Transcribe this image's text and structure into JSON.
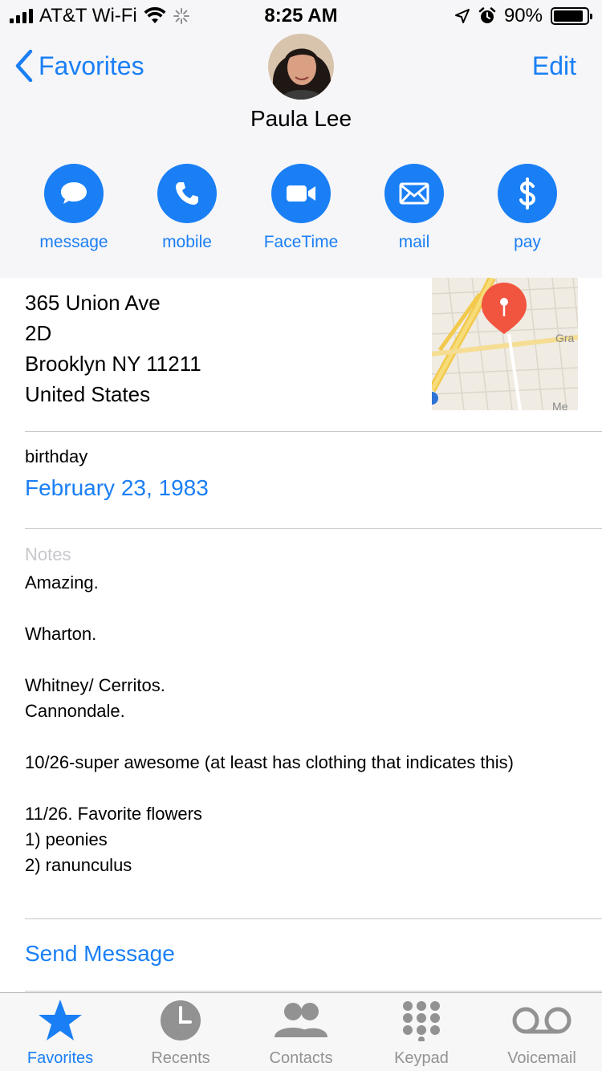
{
  "status_bar": {
    "carrier": "AT&T Wi-Fi",
    "time": "8:25 AM",
    "battery_percent": "90%",
    "battery_level": 0.9
  },
  "nav": {
    "back_label": "Favorites",
    "edit_label": "Edit"
  },
  "contact": {
    "name": "Paula Lee"
  },
  "actions": [
    {
      "label": "message",
      "icon": "message-bubble-icon"
    },
    {
      "label": "mobile",
      "icon": "phone-icon"
    },
    {
      "label": "FaceTime",
      "icon": "video-camera-icon"
    },
    {
      "label": "mail",
      "icon": "envelope-icon"
    },
    {
      "label": "pay",
      "icon": "dollar-icon"
    }
  ],
  "address": {
    "line1": "365 Union Ave",
    "line2": "2D",
    "line3": "Brooklyn  NY 11211",
    "line4": "United States"
  },
  "map": {
    "label_gra": "Gra",
    "label_me": "Me"
  },
  "birthday": {
    "label": "birthday",
    "value": "February 23, 1983"
  },
  "notes": {
    "label": "Notes",
    "text": "Amazing.\n\nWharton.\n\nWhitney/ Cerritos.\nCannondale.\n\n10/26-super awesome (at least has clothing that indicates this)\n\n11/26. Favorite flowers\n1) peonies\n2) ranunculus"
  },
  "send_message_label": "Send Message",
  "tabs": [
    {
      "label": "Favorites",
      "icon": "star-icon",
      "active": true
    },
    {
      "label": "Recents",
      "icon": "clock-icon",
      "active": false
    },
    {
      "label": "Contacts",
      "icon": "contacts-icon",
      "active": false
    },
    {
      "label": "Keypad",
      "icon": "keypad-icon",
      "active": false
    },
    {
      "label": "Voicemail",
      "icon": "voicemail-icon",
      "active": false
    }
  ],
  "colors": {
    "accent": "#1a7ff5",
    "pin": "#f2553f",
    "inactive_tab": "#929292"
  }
}
